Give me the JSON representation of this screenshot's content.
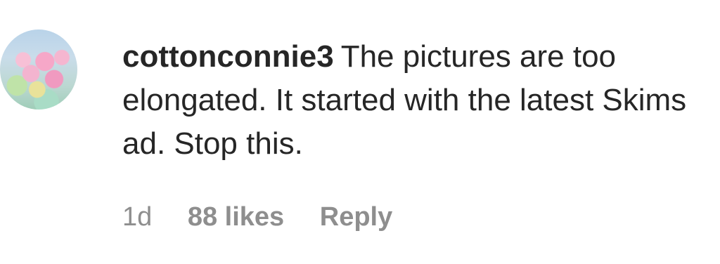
{
  "comment": {
    "username": "cottonconnie3",
    "text": "The pictures are too elongated. It started with the latest Skims ad. Stop this.",
    "timestamp": "1d",
    "likes": "88 likes",
    "reply_label": "Reply",
    "avatar_icon": "user-avatar-icon"
  }
}
